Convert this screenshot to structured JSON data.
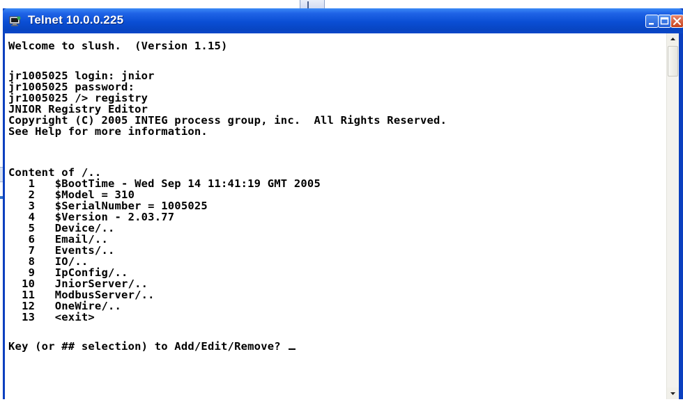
{
  "window": {
    "title": "Telnet 10.0.0.225",
    "icon": "telnet-icon",
    "controls": {
      "minimize_icon": "minimize-icon",
      "maximize_icon": "maximize-icon",
      "close_icon": "close-icon"
    }
  },
  "terminal": {
    "lines": [
      "Welcome to slush.  (Version 1.15)",
      "",
      "jr1005025 login: jnior",
      "jr1005025 password:",
      "jr1005025 /> registry",
      "JNIOR Registry Editor",
      "Copyright (C) 2005 INTEG process group, inc.  All Rights Reserved.",
      "See Help for more information.",
      "",
      "Content of /..",
      "   1   $BootTime - Wed Sep 14 11:41:19 GMT 2005",
      "   2   $Model = 310",
      "   3   $SerialNumber = 1005025",
      "   4   $Version - 2.03.77",
      "   5   Device/..",
      "   6   Email/..",
      "   7   Events/..",
      "   8   IO/..",
      "   9   IpConfig/..",
      "  10   JniorServer/..",
      "  11   ModbusServer/..",
      "  12   OneWire/..",
      "  13   <exit>",
      "",
      "Key (or ## selection) to Add/Edit/Remove? "
    ]
  },
  "colors": {
    "titlebar": "#0a4ed4",
    "terminal_bg": "#ffffff",
    "terminal_fg": "#000000"
  }
}
